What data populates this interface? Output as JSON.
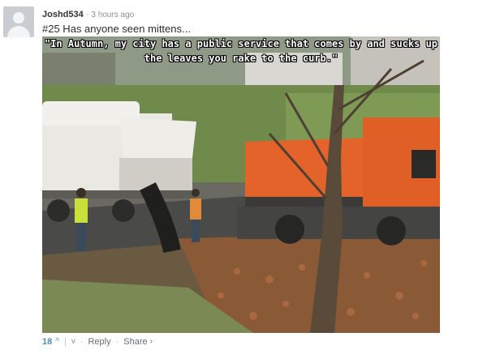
{
  "comment": {
    "author": "Joshd534",
    "separator": "·",
    "timestamp": "3 hours ago",
    "text": "#25 Has anyone seen mittens...",
    "image": {
      "caption": "\"In Autumn, my city has a public service that comes by and sucks up the leaves you rake to the curb.\""
    },
    "footer": {
      "votes": "18",
      "upvote_icon": "^",
      "pipe": "|",
      "downvote_icon": "v",
      "dot": "·",
      "reply_label": "Reply",
      "share_label": "Share",
      "share_chevron": "›"
    }
  },
  "colors": {
    "link_blue": "#4b8dc7",
    "muted_text": "#8a8f94",
    "truck_orange": "#e3632a"
  }
}
